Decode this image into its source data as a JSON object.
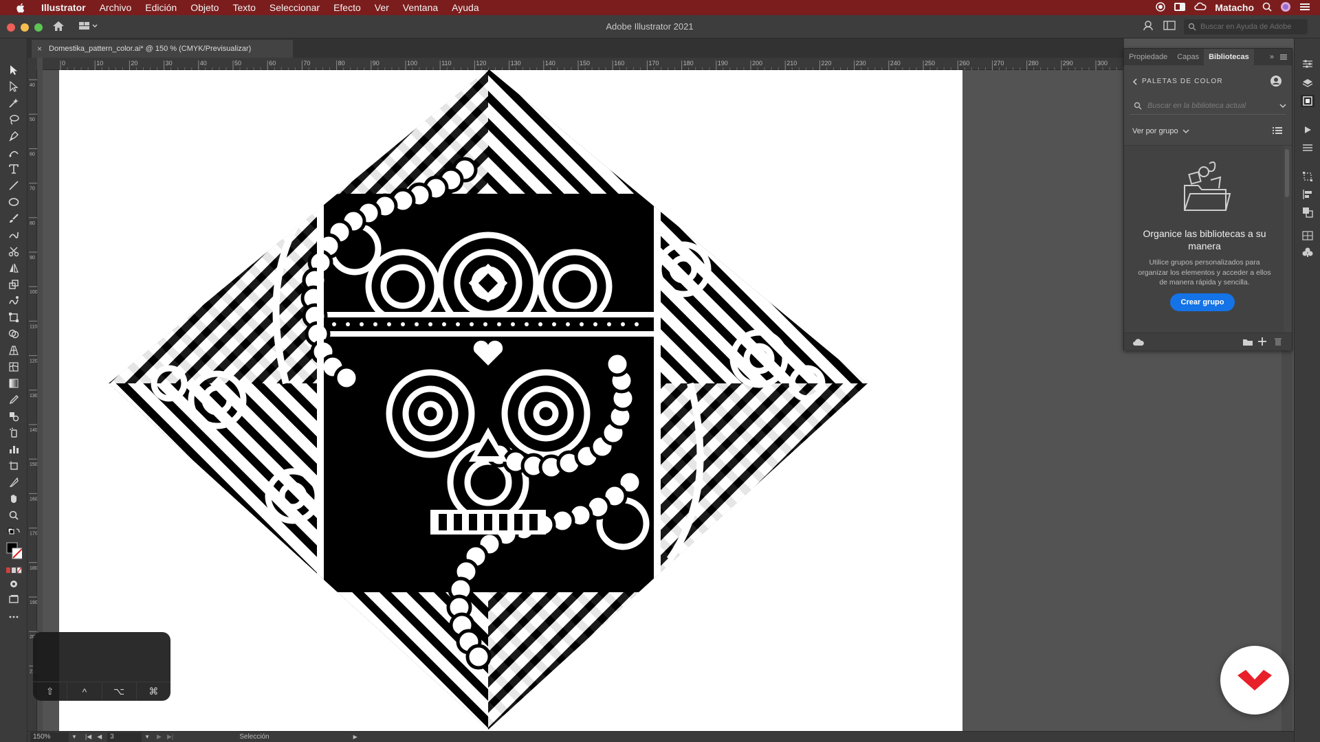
{
  "menubar": {
    "items": [
      "Illustrator",
      "Archivo",
      "Edición",
      "Objeto",
      "Texto",
      "Seleccionar",
      "Efecto",
      "Ver",
      "Ventana",
      "Ayuda"
    ],
    "user_name": "Matacho",
    "bg_color": "#7b1d1d"
  },
  "window": {
    "title": "Adobe Illustrator 2021",
    "help_search_placeholder": "Buscar en Ayuda de Adobe"
  },
  "document": {
    "tab_label": "Domestika_pattern_color.ai* @ 150 % (CMYK/Previsualizar)"
  },
  "ruler": {
    "h_ticks": [
      "0",
      "10",
      "20",
      "30",
      "40",
      "50",
      "60",
      "70",
      "80",
      "90",
      "100",
      "110",
      "120",
      "130",
      "140",
      "150",
      "160",
      "170",
      "180",
      "190",
      "200",
      "210",
      "220",
      "230",
      "240",
      "250",
      "260",
      "270",
      "280",
      "290",
      "300"
    ],
    "v_ticks": [
      "40",
      "50",
      "60",
      "70",
      "80",
      "90",
      "100",
      "110",
      "120",
      "130",
      "140",
      "150",
      "160",
      "170",
      "180",
      "190",
      "200",
      "210"
    ]
  },
  "panel": {
    "tabs": [
      "Propiedade",
      "Capas",
      "Bibliotecas"
    ],
    "active_tab": "Bibliotecas",
    "back_label": "PALETAS DE COLOR",
    "search_placeholder": "Buscar en la biblioteca actual",
    "view_by": "Ver por grupo",
    "empty_title": "Organice las bibliotecas a su manera",
    "empty_desc": "Utilice grupos personalizados para organizar los elementos y acceder a ellos de manera rápida y sencilla.",
    "create_button": "Crear grupo",
    "accent_color": "#1473e6"
  },
  "keys_overlay": {
    "keys": [
      "⇧",
      "^",
      "⌥",
      "⌘"
    ]
  },
  "statusbar": {
    "zoom": "150%",
    "page": "3",
    "status": "Selección"
  },
  "toolbar": {
    "tools": [
      "selection-tool",
      "direct-selection-tool",
      "magic-wand-tool",
      "lasso-tool",
      "pen-tool",
      "curvature-tool",
      "type-tool",
      "line-tool",
      "ellipse-tool",
      "paintbrush-tool",
      "shaper-tool",
      "scissors-tool",
      "reflect-tool",
      "scale-tool",
      "warp-tool",
      "free-transform-tool",
      "shape-builder-tool",
      "mesh-tool",
      "gradient-tool",
      "eyedropper-tool",
      "blend-tool",
      "symbol-sprayer-tool",
      "column-graph-tool",
      "artboard-tool",
      "slice-tool",
      "hand-tool",
      "zoom-tool"
    ]
  }
}
